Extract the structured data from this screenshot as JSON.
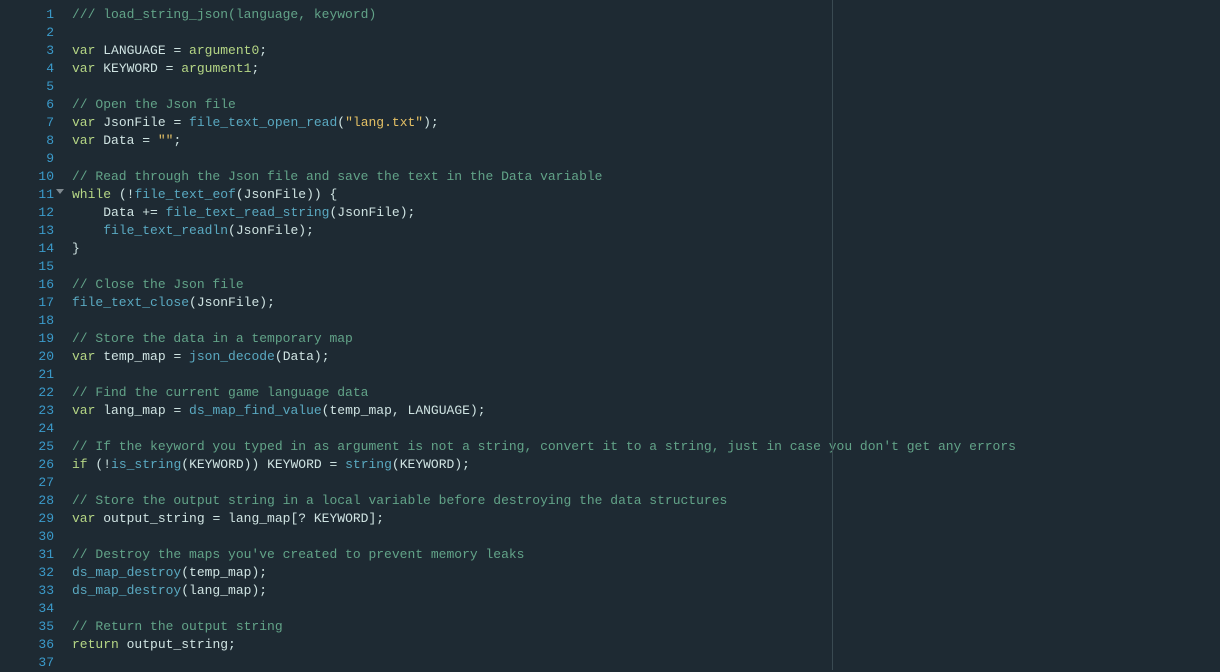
{
  "editor": {
    "total_lines": 37,
    "fold_at_line": 11,
    "lines": [
      {
        "n": 1,
        "tokens": [
          {
            "t": "/// load_string_json(language, keyword)",
            "c": "cm"
          }
        ]
      },
      {
        "n": 2,
        "tokens": []
      },
      {
        "n": 3,
        "tokens": [
          {
            "t": "var",
            "c": "kw"
          },
          {
            "t": " ",
            "c": "pl"
          },
          {
            "t": "LANGUAGE",
            "c": "id"
          },
          {
            "t": " = ",
            "c": "op"
          },
          {
            "t": "argument0",
            "c": "kw"
          },
          {
            "t": ";",
            "c": "pun"
          }
        ]
      },
      {
        "n": 4,
        "tokens": [
          {
            "t": "var",
            "c": "kw"
          },
          {
            "t": " ",
            "c": "pl"
          },
          {
            "t": "KEYWORD",
            "c": "id"
          },
          {
            "t": " = ",
            "c": "op"
          },
          {
            "t": "argument1",
            "c": "kw"
          },
          {
            "t": ";",
            "c": "pun"
          }
        ]
      },
      {
        "n": 5,
        "tokens": []
      },
      {
        "n": 6,
        "tokens": [
          {
            "t": "// Open the Json file",
            "c": "cm"
          }
        ]
      },
      {
        "n": 7,
        "tokens": [
          {
            "t": "var",
            "c": "kw"
          },
          {
            "t": " ",
            "c": "pl"
          },
          {
            "t": "JsonFile",
            "c": "id"
          },
          {
            "t": " = ",
            "c": "op"
          },
          {
            "t": "file_text_open_read",
            "c": "fn"
          },
          {
            "t": "(",
            "c": "pun"
          },
          {
            "t": "\"lang.txt\"",
            "c": "str"
          },
          {
            "t": ")",
            "c": "pun"
          },
          {
            "t": ";",
            "c": "pun"
          }
        ]
      },
      {
        "n": 8,
        "tokens": [
          {
            "t": "var",
            "c": "kw"
          },
          {
            "t": " ",
            "c": "pl"
          },
          {
            "t": "Data",
            "c": "id"
          },
          {
            "t": " = ",
            "c": "op"
          },
          {
            "t": "\"\"",
            "c": "str"
          },
          {
            "t": ";",
            "c": "pun"
          }
        ]
      },
      {
        "n": 9,
        "tokens": []
      },
      {
        "n": 10,
        "tokens": [
          {
            "t": "// Read through the Json file and save the text in the Data variable",
            "c": "cm"
          }
        ]
      },
      {
        "n": 11,
        "tokens": [
          {
            "t": "while",
            "c": "kw"
          },
          {
            "t": " (",
            "c": "pun"
          },
          {
            "t": "!",
            "c": "op"
          },
          {
            "t": "file_text_eof",
            "c": "fn"
          },
          {
            "t": "(",
            "c": "pun"
          },
          {
            "t": "JsonFile",
            "c": "id"
          },
          {
            "t": ")) ",
            "c": "pun"
          },
          {
            "t": "{",
            "c": "pun"
          }
        ]
      },
      {
        "n": 12,
        "tokens": [
          {
            "t": "    ",
            "c": "pl"
          },
          {
            "t": "Data",
            "c": "id"
          },
          {
            "t": " += ",
            "c": "op"
          },
          {
            "t": "file_text_read_string",
            "c": "fn"
          },
          {
            "t": "(",
            "c": "pun"
          },
          {
            "t": "JsonFile",
            "c": "id"
          },
          {
            "t": ")",
            "c": "pun"
          },
          {
            "t": ";",
            "c": "pun"
          }
        ]
      },
      {
        "n": 13,
        "tokens": [
          {
            "t": "    ",
            "c": "pl"
          },
          {
            "t": "file_text_readln",
            "c": "fn"
          },
          {
            "t": "(",
            "c": "pun"
          },
          {
            "t": "JsonFile",
            "c": "id"
          },
          {
            "t": ")",
            "c": "pun"
          },
          {
            "t": ";",
            "c": "pun"
          }
        ]
      },
      {
        "n": 14,
        "tokens": [
          {
            "t": "}",
            "c": "pun"
          }
        ]
      },
      {
        "n": 15,
        "tokens": []
      },
      {
        "n": 16,
        "tokens": [
          {
            "t": "// Close the Json file",
            "c": "cm"
          }
        ]
      },
      {
        "n": 17,
        "tokens": [
          {
            "t": "file_text_close",
            "c": "fn"
          },
          {
            "t": "(",
            "c": "pun"
          },
          {
            "t": "JsonFile",
            "c": "id"
          },
          {
            "t": ")",
            "c": "pun"
          },
          {
            "t": ";",
            "c": "pun"
          }
        ]
      },
      {
        "n": 18,
        "tokens": []
      },
      {
        "n": 19,
        "tokens": [
          {
            "t": "// Store the data in a temporary map",
            "c": "cm"
          }
        ]
      },
      {
        "n": 20,
        "tokens": [
          {
            "t": "var",
            "c": "kw"
          },
          {
            "t": " ",
            "c": "pl"
          },
          {
            "t": "temp_map",
            "c": "id"
          },
          {
            "t": " = ",
            "c": "op"
          },
          {
            "t": "json_decode",
            "c": "fn"
          },
          {
            "t": "(",
            "c": "pun"
          },
          {
            "t": "Data",
            "c": "id"
          },
          {
            "t": ")",
            "c": "pun"
          },
          {
            "t": ";",
            "c": "pun"
          }
        ]
      },
      {
        "n": 21,
        "tokens": []
      },
      {
        "n": 22,
        "tokens": [
          {
            "t": "// Find the current game language data",
            "c": "cm"
          }
        ]
      },
      {
        "n": 23,
        "tokens": [
          {
            "t": "var",
            "c": "kw"
          },
          {
            "t": " ",
            "c": "pl"
          },
          {
            "t": "lang_map",
            "c": "id"
          },
          {
            "t": " = ",
            "c": "op"
          },
          {
            "t": "ds_map_find_value",
            "c": "fn"
          },
          {
            "t": "(",
            "c": "pun"
          },
          {
            "t": "temp_map",
            "c": "id"
          },
          {
            "t": ", ",
            "c": "pun"
          },
          {
            "t": "LANGUAGE",
            "c": "id"
          },
          {
            "t": ")",
            "c": "pun"
          },
          {
            "t": ";",
            "c": "pun"
          }
        ]
      },
      {
        "n": 24,
        "tokens": []
      },
      {
        "n": 25,
        "tokens": [
          {
            "t": "// If the keyword you typed in as argument is not a string, convert it to a string, just in case you don't get any errors",
            "c": "cm"
          }
        ]
      },
      {
        "n": 26,
        "tokens": [
          {
            "t": "if",
            "c": "kw"
          },
          {
            "t": " (",
            "c": "pun"
          },
          {
            "t": "!",
            "c": "op"
          },
          {
            "t": "is_string",
            "c": "fn"
          },
          {
            "t": "(",
            "c": "pun"
          },
          {
            "t": "KEYWORD",
            "c": "id"
          },
          {
            "t": ")) ",
            "c": "pun"
          },
          {
            "t": "KEYWORD",
            "c": "id"
          },
          {
            "t": " = ",
            "c": "op"
          },
          {
            "t": "string",
            "c": "fn"
          },
          {
            "t": "(",
            "c": "pun"
          },
          {
            "t": "KEYWORD",
            "c": "id"
          },
          {
            "t": ")",
            "c": "pun"
          },
          {
            "t": ";",
            "c": "pun"
          }
        ]
      },
      {
        "n": 27,
        "tokens": []
      },
      {
        "n": 28,
        "tokens": [
          {
            "t": "// Store the output string in a local variable before destroying the data structures",
            "c": "cm"
          }
        ]
      },
      {
        "n": 29,
        "tokens": [
          {
            "t": "var",
            "c": "kw"
          },
          {
            "t": " ",
            "c": "pl"
          },
          {
            "t": "output_string",
            "c": "id"
          },
          {
            "t": " = ",
            "c": "op"
          },
          {
            "t": "lang_map",
            "c": "id"
          },
          {
            "t": "[? ",
            "c": "pun"
          },
          {
            "t": "KEYWORD",
            "c": "id"
          },
          {
            "t": "]",
            "c": "pun"
          },
          {
            "t": ";",
            "c": "pun"
          }
        ]
      },
      {
        "n": 30,
        "tokens": []
      },
      {
        "n": 31,
        "tokens": [
          {
            "t": "// Destroy the maps you've created to prevent memory leaks",
            "c": "cm"
          }
        ]
      },
      {
        "n": 32,
        "tokens": [
          {
            "t": "ds_map_destroy",
            "c": "fn"
          },
          {
            "t": "(",
            "c": "pun"
          },
          {
            "t": "temp_map",
            "c": "id"
          },
          {
            "t": ")",
            "c": "pun"
          },
          {
            "t": ";",
            "c": "pun"
          }
        ]
      },
      {
        "n": 33,
        "tokens": [
          {
            "t": "ds_map_destroy",
            "c": "fn"
          },
          {
            "t": "(",
            "c": "pun"
          },
          {
            "t": "lang_map",
            "c": "id"
          },
          {
            "t": ")",
            "c": "pun"
          },
          {
            "t": ";",
            "c": "pun"
          }
        ]
      },
      {
        "n": 34,
        "tokens": []
      },
      {
        "n": 35,
        "tokens": [
          {
            "t": "// Return the output string",
            "c": "cm"
          }
        ]
      },
      {
        "n": 36,
        "tokens": [
          {
            "t": "return",
            "c": "kw"
          },
          {
            "t": " ",
            "c": "pl"
          },
          {
            "t": "output_string",
            "c": "id"
          },
          {
            "t": ";",
            "c": "pun"
          }
        ]
      },
      {
        "n": 37,
        "tokens": []
      }
    ]
  }
}
